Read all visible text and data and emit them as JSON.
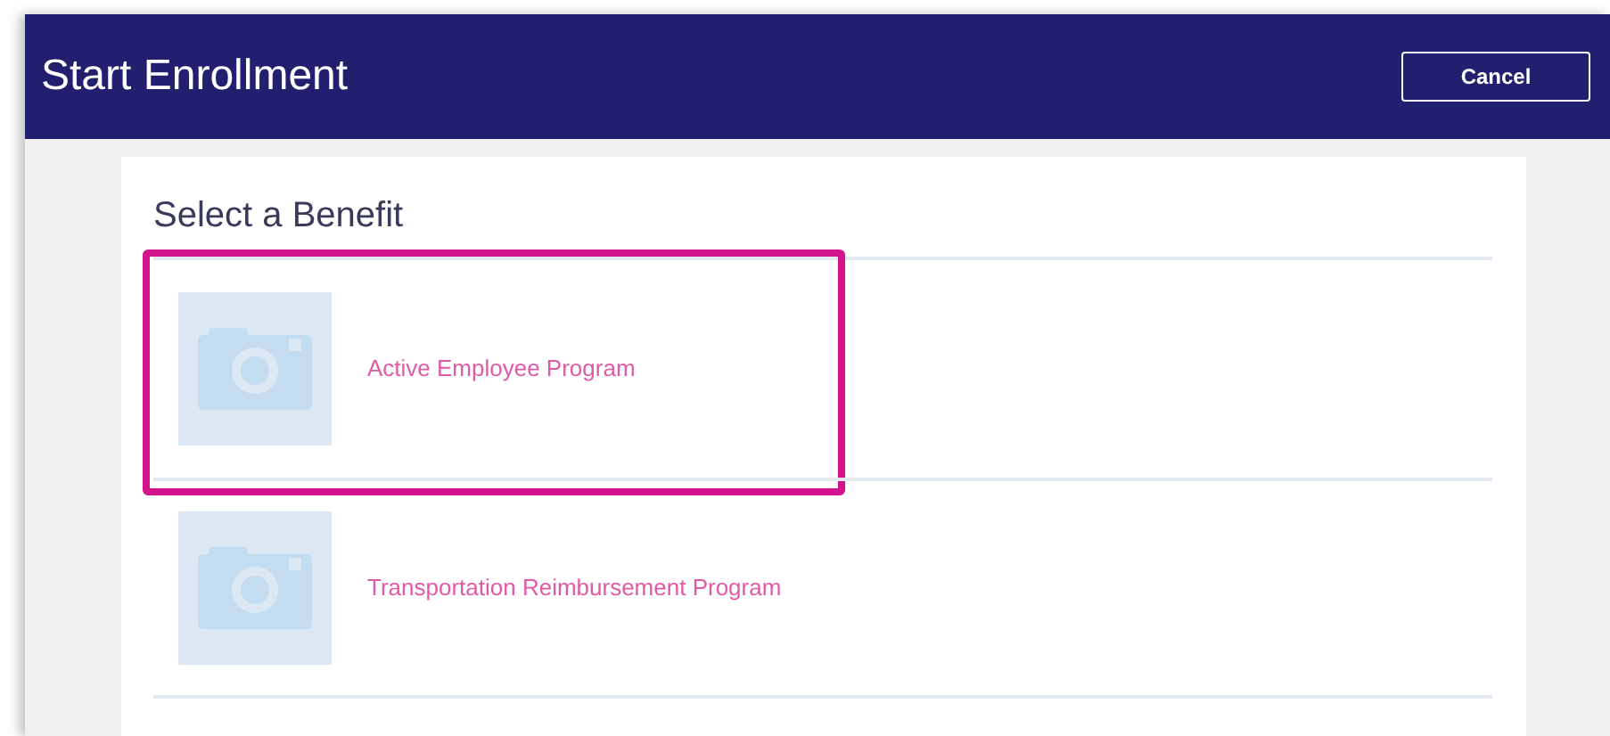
{
  "window": {
    "title": "Start Enrollment"
  },
  "header_buttons": [
    {
      "label": "Cancel"
    }
  ],
  "section": {
    "title": "Select a Benefit"
  },
  "benefits": [
    {
      "name": "Active Employee Program",
      "highlighted": true
    },
    {
      "name": "Transportation Reimbursement Program",
      "highlighted": false
    }
  ]
}
